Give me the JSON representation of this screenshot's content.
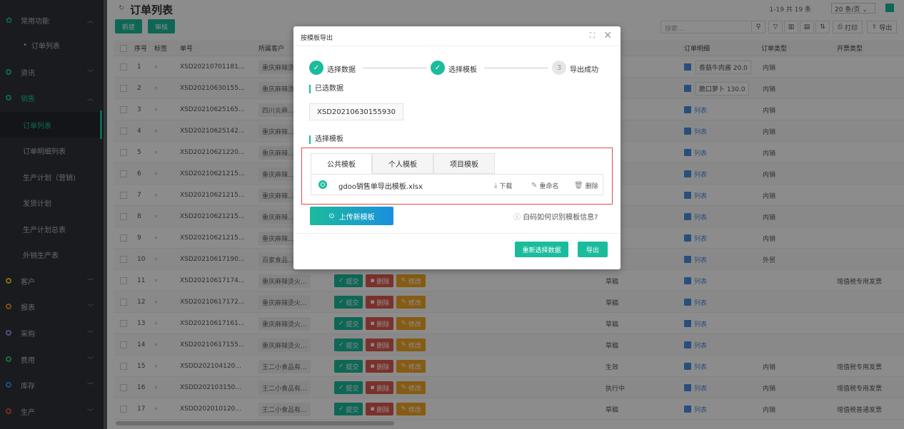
{
  "sidebar": {
    "common": "常用功能",
    "common_sub": "订单列表",
    "info": "资讯",
    "sales": "销售",
    "sales_items": [
      "订单列表",
      "订单明细列表",
      "生产计划（营销)",
      "发货计划",
      "生产计划总表",
      "外销生产表"
    ],
    "customer": "客户",
    "report": "报表",
    "purchase": "采购",
    "expense": "费用",
    "inventory": "库存",
    "production": "生产"
  },
  "header": {
    "title": "订单列表",
    "page_info": "1-19 共 19 条",
    "page_size": "20 条/页",
    "btn_new": "新建",
    "btn_audit": "审核",
    "search_placeholder": "搜索...",
    "print": "打印",
    "export": "导出"
  },
  "table": {
    "headers": [
      "序号",
      "标签",
      "单号",
      "所属客户",
      "订单明细",
      "订单类型",
      "开票类型"
    ],
    "rows": [
      {
        "n": "1",
        "no": "XSD20210701181...",
        "cust": "重庆麻辣烫火...",
        "detail": "香菇牛肉酱 20.0",
        "type": "内销",
        "status": "",
        "invoice": ""
      },
      {
        "n": "2",
        "no": "XSD20210630155...",
        "cust": "重庆麻辣烫火...",
        "detail": "脆口萝卜 130.0",
        "type": "内销",
        "status": "",
        "invoice": ""
      },
      {
        "n": "3",
        "no": "XSD20210625165...",
        "cust": "四川炎麻...",
        "detail": "列表",
        "type": "内销",
        "status": "",
        "invoice": ""
      },
      {
        "n": "4",
        "no": "XSD20210625142...",
        "cust": "重庆麻辣...",
        "detail": "列表",
        "type": "内销",
        "status": "",
        "invoice": ""
      },
      {
        "n": "5",
        "no": "XSD20210621220...",
        "cust": "重庆麻辣...",
        "detail": "列表",
        "type": "内销",
        "status": "",
        "invoice": ""
      },
      {
        "n": "6",
        "no": "XSD20210621215...",
        "cust": "重庆麻辣...",
        "detail": "列表",
        "type": "内销",
        "status": "",
        "invoice": ""
      },
      {
        "n": "7",
        "no": "XSD20210621215...",
        "cust": "重庆麻辣...",
        "detail": "列表",
        "type": "内销",
        "status": "",
        "invoice": ""
      },
      {
        "n": "8",
        "no": "XSD20210621215...",
        "cust": "重庆麻辣...",
        "detail": "列表",
        "type": "内销",
        "status": "",
        "invoice": ""
      },
      {
        "n": "9",
        "no": "XSD20210621215...",
        "cust": "重庆麻辣...",
        "detail": "列表",
        "type": "内销",
        "status": "",
        "invoice": ""
      },
      {
        "n": "10",
        "no": "XSD20210617190...",
        "cust": "百家食品...",
        "detail": "列表",
        "type": "外贸",
        "status": "",
        "invoice": ""
      },
      {
        "n": "11",
        "no": "XSD20210617174...",
        "cust": "重庆麻辣烫火...",
        "detail": "列表",
        "type": "",
        "status": "草稿",
        "invoice": "增值税专用发票"
      },
      {
        "n": "12",
        "no": "XSD20210617172...",
        "cust": "重庆麻辣烫火...",
        "detail": "列表",
        "type": "",
        "status": "草稿",
        "invoice": ""
      },
      {
        "n": "13",
        "no": "XSD20210617161...",
        "cust": "重庆麻辣烫火...",
        "detail": "列表",
        "type": "",
        "status": "草稿",
        "invoice": ""
      },
      {
        "n": "14",
        "no": "XSD20210617155...",
        "cust": "重庆麻辣烫火...",
        "detail": "列表",
        "type": "",
        "status": "草稿",
        "invoice": ""
      },
      {
        "n": "15",
        "no": "XSDD202104120...",
        "cust": "王二小食品有...",
        "detail": "列表",
        "type": "内销",
        "status": "生效",
        "invoice": "增值税专用发票"
      },
      {
        "n": "16",
        "no": "XSDD202103150...",
        "cust": "王二小食品有...",
        "detail": "列表",
        "type": "内销",
        "status": "执行中",
        "invoice": "增值税专用发票"
      },
      {
        "n": "17",
        "no": "XSDD202010120...",
        "cust": "王二小食品有...",
        "detail": "列表",
        "type": "内销",
        "status": "草稿",
        "invoice": "增值税普通发票"
      }
    ],
    "actions": {
      "submit": "提交",
      "delete": "删除",
      "edit": "修改"
    }
  },
  "modal": {
    "title": "按模板导出",
    "steps": [
      "选择数据",
      "选择模板",
      "导出成功"
    ],
    "step3_num": "3",
    "selected_label": "已选数据",
    "selected_value": "XSD20210630155930",
    "choose_label": "选择模板",
    "tabs": [
      "公共模板",
      "个人模板",
      "项目模板"
    ],
    "template_name": "gdoo销售单导出模板.xlsx",
    "download": "下载",
    "rename": "重命名",
    "delete": "删除",
    "upload": "上传新模板",
    "help": "白码如何识别模板信息?",
    "reselect": "重新选择数据",
    "export": "导出"
  }
}
